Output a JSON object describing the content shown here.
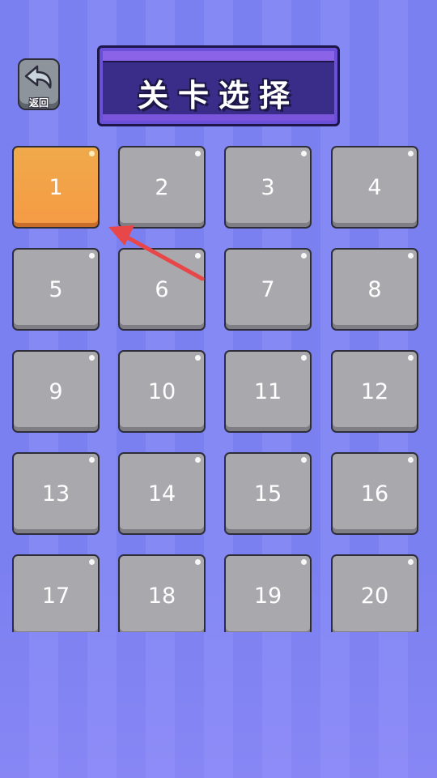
{
  "header": {
    "back_label": "返回",
    "back_icon": "curved-back-arrow-icon",
    "title": "关卡选择"
  },
  "levels": [
    {
      "label": "1",
      "state": "selected"
    },
    {
      "label": "2",
      "state": "locked"
    },
    {
      "label": "3",
      "state": "locked"
    },
    {
      "label": "4",
      "state": "locked"
    },
    {
      "label": "5",
      "state": "locked"
    },
    {
      "label": "6",
      "state": "locked"
    },
    {
      "label": "7",
      "state": "locked"
    },
    {
      "label": "8",
      "state": "locked"
    },
    {
      "label": "9",
      "state": "locked"
    },
    {
      "label": "10",
      "state": "locked"
    },
    {
      "label": "11",
      "state": "locked"
    },
    {
      "label": "12",
      "state": "locked"
    },
    {
      "label": "13",
      "state": "locked"
    },
    {
      "label": "14",
      "state": "locked"
    },
    {
      "label": "15",
      "state": "locked"
    },
    {
      "label": "16",
      "state": "locked"
    },
    {
      "label": "17",
      "state": "locked"
    },
    {
      "label": "18",
      "state": "locked"
    },
    {
      "label": "19",
      "state": "locked"
    },
    {
      "label": "20",
      "state": "locked"
    }
  ],
  "colors": {
    "background": "#7b80f0",
    "selected_level": "#f5a347",
    "locked_level": "#a9a9ad",
    "title_banner": "#3a2d8a",
    "annotation_arrow": "#e8474a"
  }
}
